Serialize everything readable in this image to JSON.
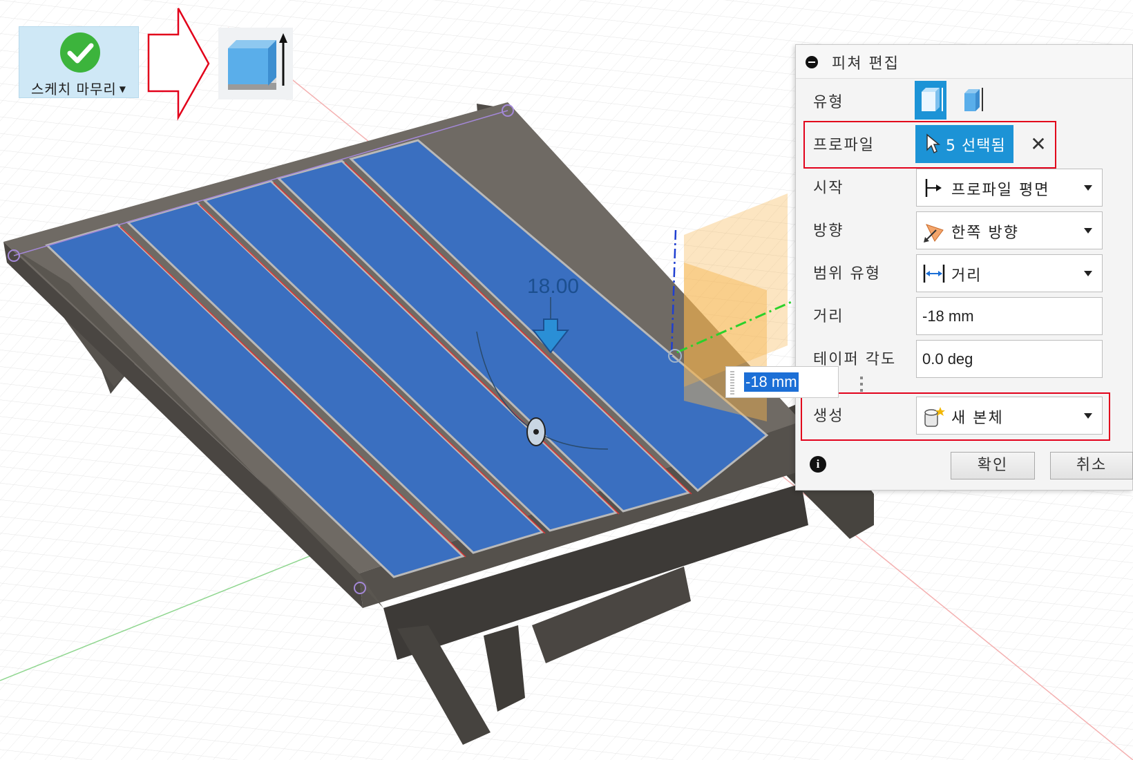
{
  "toolbar": {
    "finish_sketch_label": "스케치 마무리",
    "finish_sketch_icon": "checkmark-icon",
    "extrude_icon": "extrude-icon",
    "arrow_icon": "red-outline-arrow-icon"
  },
  "viewport": {
    "dimension_label": "18.00",
    "distance_input_value": "-18 mm"
  },
  "panel": {
    "title": "피쳐 편집",
    "rows": {
      "type": {
        "label": "유형"
      },
      "profile": {
        "label": "프로파일",
        "value": "5 선택됨"
      },
      "start": {
        "label": "시작",
        "value": "프로파일 평면"
      },
      "direction": {
        "label": "방향",
        "value": "한쪽 방향"
      },
      "extent_type": {
        "label": "범위 유형",
        "value": "거리"
      },
      "distance": {
        "label": "거리",
        "value": "-18 mm"
      },
      "taper_angle": {
        "label": "테이퍼 각도",
        "value": "0.0 deg"
      },
      "operation": {
        "label": "생성",
        "value": "새 본체"
      }
    },
    "ok_label": "확인",
    "cancel_label": "취소"
  },
  "colors": {
    "selection_blue": "#3a6fc0",
    "body_dark": "#5e5a55",
    "accent": "#1c93d6",
    "highlight_red": "#e2001a"
  }
}
